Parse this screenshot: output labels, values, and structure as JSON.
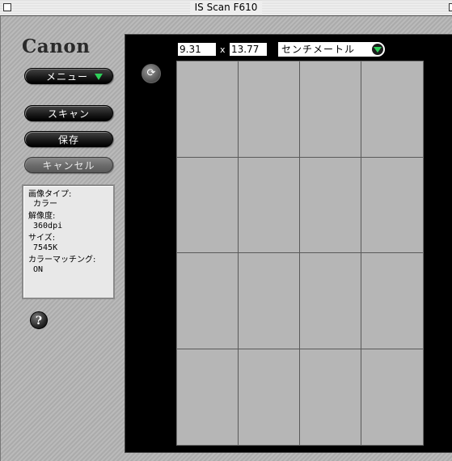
{
  "window": {
    "title": "IS Scan F610"
  },
  "logo": {
    "text": "Canon"
  },
  "buttons": {
    "menu_label": "メニュー",
    "scan_label": "スキャン",
    "save_label": "保存",
    "cancel_label": "キャンセル",
    "help_label": "?"
  },
  "info": {
    "image_type_label": "画像タイプ:",
    "image_type_value": "カラー",
    "resolution_label": "解像度:",
    "resolution_value": "360dpi",
    "size_label": "サイズ:",
    "size_value": "7545K",
    "color_matching_label": "カラーマッチング:",
    "color_matching_value": "ON"
  },
  "dimensions": {
    "width": "9.31",
    "times": "x",
    "height": "13.77",
    "unit": "センチメートル"
  },
  "colors": {
    "accent_arrow": "#2fd15a",
    "preview_background": "#000000",
    "scan_area": "#b6b6b6"
  },
  "icons": [
    "close-box-icon",
    "zoom-box-icon",
    "chevron-down-icon",
    "rotate-icon",
    "help-icon"
  ]
}
